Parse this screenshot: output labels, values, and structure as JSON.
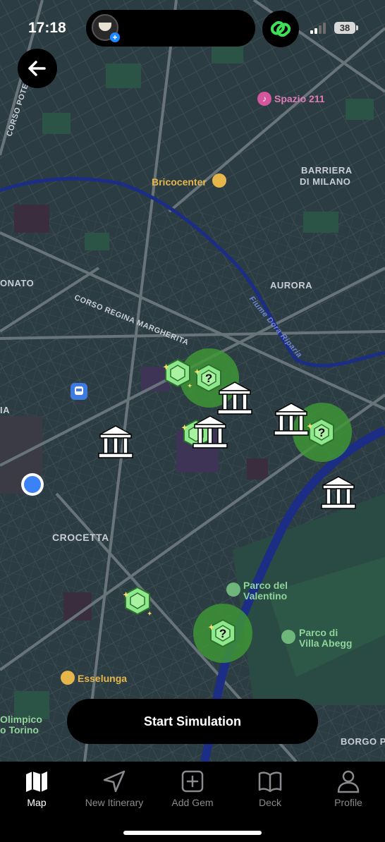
{
  "status": {
    "time": "17:18",
    "battery": "38"
  },
  "map": {
    "labels": {
      "corso_potenza": "CORSO POTE",
      "barriera_1": "BARRIERA",
      "barriera_2": "DI MILANO",
      "onato": "ONATO",
      "corso_regina": "CORSO REGINA MARGHERITA",
      "aurora": "AURORA",
      "fiume_dora": "Fiume Dora Riparia",
      "ia": "IA",
      "crocetta": "CROCETTA",
      "borgo": "BORGO P"
    },
    "pois": {
      "spazio": "Spazio 211",
      "bricocenter": "Bricocenter",
      "parco_valentino_1": "Parco del",
      "parco_valentino_2": "Valentino",
      "parco_villa_1": "Parco di",
      "parco_villa_2": "Villa Abegg",
      "esselunga": "Esselunga",
      "olimpico_1": "Olimpico",
      "olimpico_2": "o Torino"
    },
    "colors": {
      "background": "#2b3c42",
      "road": "#4c5a61",
      "major_road": "#6b7479",
      "river": "#1c2d86",
      "gem": "#8ce88a",
      "highlight": "#3f9a34",
      "user_location": "#3b82f6"
    }
  },
  "actions": {
    "start_simulation": "Start Simulation"
  },
  "tabs": [
    {
      "label": "Map",
      "icon": "map-icon",
      "active": true
    },
    {
      "label": "New Itinerary",
      "icon": "navigation-arrow-icon",
      "active": false
    },
    {
      "label": "Add Gem",
      "icon": "plus-square-icon",
      "active": false
    },
    {
      "label": "Deck",
      "icon": "book-icon",
      "active": false
    },
    {
      "label": "Profile",
      "icon": "person-icon",
      "active": false
    }
  ]
}
